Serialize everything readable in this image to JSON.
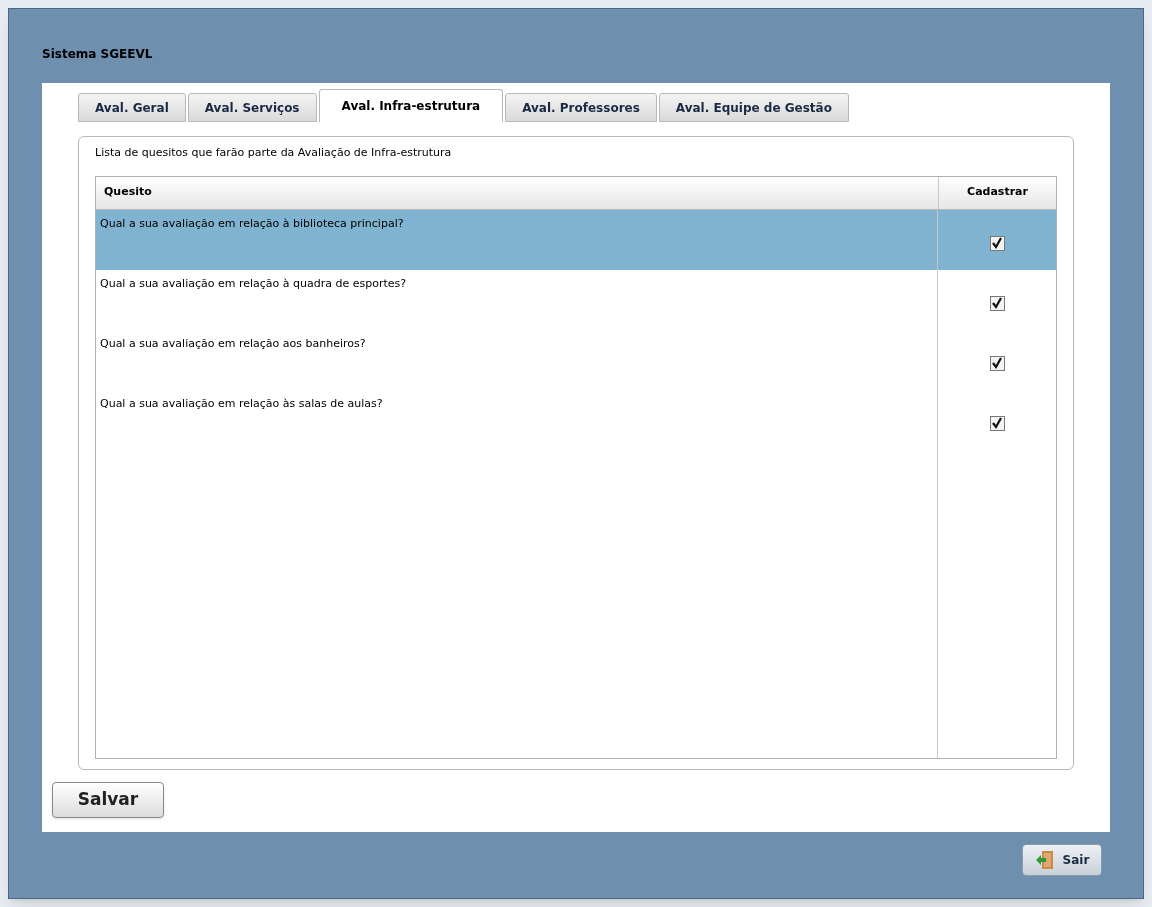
{
  "window": {
    "title": "Sistema SGEEVL"
  },
  "tabs": [
    {
      "label": "Aval. Geral",
      "selected": false
    },
    {
      "label": "Aval. Serviços",
      "selected": false
    },
    {
      "label": "Aval. Infra-estrutura",
      "selected": true
    },
    {
      "label": "Aval. Professores",
      "selected": false
    },
    {
      "label": "Aval. Equipe de Gestão",
      "selected": false
    }
  ],
  "panel": {
    "caption": "Lista de quesitos que farão parte da Avaliação de Infra-estrutura"
  },
  "table": {
    "columns": [
      "Quesito",
      "Cadastrar"
    ],
    "rows": [
      {
        "quesito": "Qual a sua avaliação em relação à biblioteca principal?",
        "checked": true,
        "selected": true
      },
      {
        "quesito": "Qual a sua avaliação em relação à quadra de esportes?",
        "checked": true,
        "selected": false
      },
      {
        "quesito": "Qual a sua avaliação em relação aos banheiros?",
        "checked": true,
        "selected": false
      },
      {
        "quesito": "Qual a sua avaliação em relação às salas de aulas?",
        "checked": true,
        "selected": false
      }
    ]
  },
  "buttons": {
    "save": "Salvar",
    "exit": "Sair"
  }
}
